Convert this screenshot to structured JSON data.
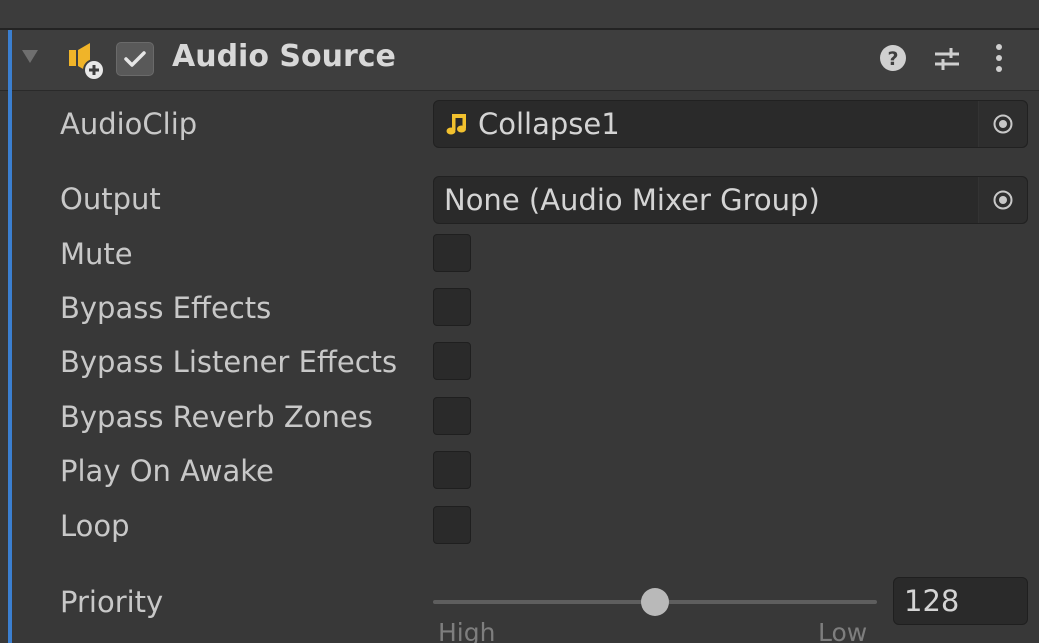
{
  "component": {
    "title": "Audio Source",
    "icon": "audio-source-icon",
    "enabled": true,
    "header_icons": [
      "help-icon",
      "presets-icon",
      "more-menu-icon"
    ]
  },
  "properties": {
    "audio_clip": {
      "label": "AudioClip",
      "value": "Collapse1",
      "value_icon": "music-note-icon"
    },
    "output": {
      "label": "Output",
      "value": "None (Audio Mixer Group)"
    },
    "mute": {
      "label": "Mute",
      "checked": false
    },
    "bypass_effects": {
      "label": "Bypass Effects",
      "checked": false
    },
    "bypass_listener_effects": {
      "label": "Bypass Listener Effects",
      "checked": false
    },
    "bypass_reverb_zones": {
      "label": "Bypass Reverb Zones",
      "checked": false
    },
    "play_on_awake": {
      "label": "Play On Awake",
      "checked": false
    },
    "loop": {
      "label": "Loop",
      "checked": false
    },
    "priority": {
      "label": "Priority",
      "value": "128",
      "min_label": "High",
      "max_label": "Low",
      "min": 0,
      "max": 256
    }
  },
  "colors": {
    "accent": "#3b7fd0",
    "background": "#383838",
    "field": "#2a2a2a",
    "note": "#f2c12e"
  }
}
